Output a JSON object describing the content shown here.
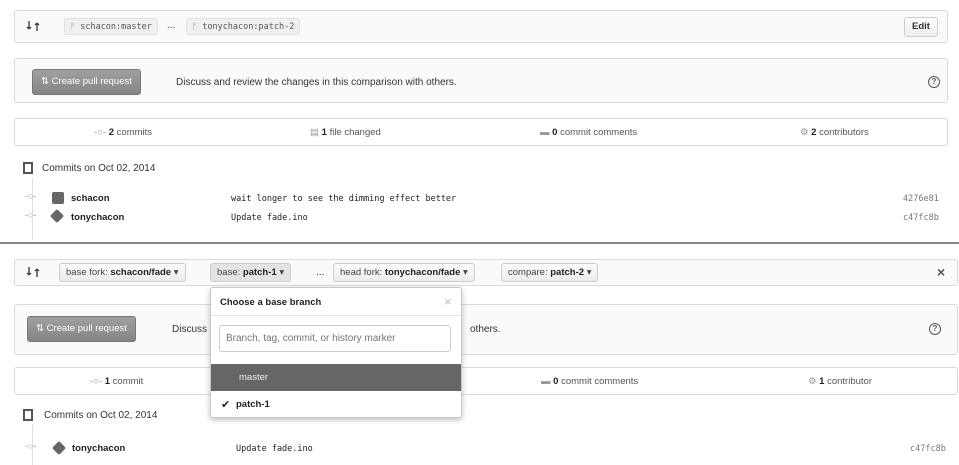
{
  "top": {
    "base_ref": "schacon:master",
    "ellipsis": "...",
    "head_ref": "tonychacon:patch-2",
    "edit_label": "Edit",
    "create_pr_label": "Create pull request",
    "discuss_text": "Discuss and review the changes in this comparison with others.",
    "stats": {
      "commits_count": "2",
      "commits_label": "commits",
      "files_count": "1",
      "files_label": "file changed",
      "comments_count": "0",
      "comments_label": "commit comments",
      "contributors_count": "2",
      "contributors_label": "contributors"
    },
    "commits_header": "Commits on Oct 02, 2014",
    "commits": [
      {
        "author": "schacon",
        "message": "wait longer to see the dimming effect better",
        "sha": "4276e81"
      },
      {
        "author": "tonychacon",
        "message": "Update fade.ino",
        "sha": "c47fc8b"
      }
    ]
  },
  "bottom": {
    "base_fork_prefix": "base fork:",
    "base_fork_value": "schacon/fade",
    "base_prefix": "base:",
    "base_value": "patch-1",
    "ellipsis": "...",
    "head_fork_prefix": "head fork:",
    "head_fork_value": "tonychacon/fade",
    "compare_prefix": "compare:",
    "compare_value": "patch-2",
    "close_glyph": "×",
    "create_pr_label": "Create pull request",
    "discuss_text_start": "Discuss",
    "discuss_text_end": "others.",
    "stats": {
      "commits_count": "1",
      "commits_label": "commit",
      "comments_count": "0",
      "comments_label": "commit comments",
      "contributors_count": "1",
      "contributors_label": "contributor"
    },
    "commits_header": "Commits on Oct 02, 2014",
    "commits": [
      {
        "author": "tonychacon",
        "message": "Update fade.ino",
        "sha": "c47fc8b"
      }
    ]
  },
  "dropdown": {
    "title": "Choose a base branch",
    "close_glyph": "×",
    "filter_placeholder": "Branch, tag, commit, or history marker",
    "items": [
      {
        "label": "master",
        "highlighted": true,
        "selected": false
      },
      {
        "label": "patch-1",
        "highlighted": false,
        "selected": true
      }
    ]
  },
  "colors": {
    "highlight": "#666666",
    "button_gray": "#8f8f8f",
    "border": "#dadada"
  }
}
